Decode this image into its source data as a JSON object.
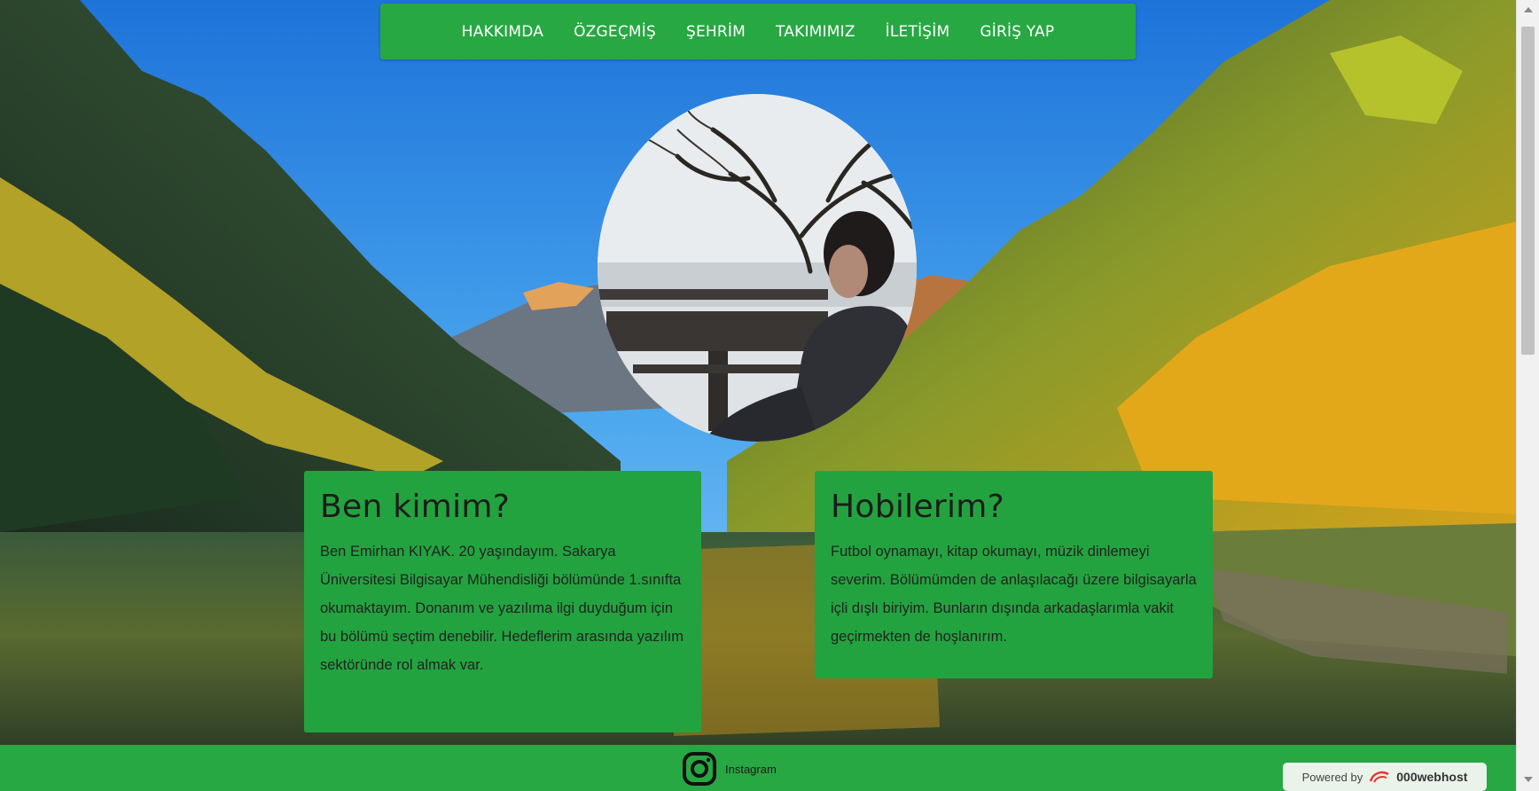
{
  "nav": {
    "items": [
      "HAKKIMDA",
      "ÖZGEÇMİŞ",
      "ŞEHRİM",
      "TAKIMIMIZ",
      "İLETİŞİM",
      "GİRİŞ YAP"
    ]
  },
  "about": {
    "title": "Ben kimim?",
    "text": "Ben Emirhan KIYAK. 20 yaşındayım. Sakarya Üniversitesi Bilgisayar Mühendisliği bölümünde 1.sınıfta okumaktayım. Donanım ve yazılıma ilgi duyduğum için bu bölümü seçtim denebilir. Hedeflerim arasında yazılım sektöründe rol almak var."
  },
  "hobbies": {
    "title": "Hobilerim?",
    "text": "Futbol oynamayı, kitap okumayı, müzik dinlemeyi severim. Bölümümden de anlaşılacağı üzere bilgisayarla içli dışlı biriyim. Bunların dışında arkadaşlarımla vakit geçirmekten de hoşlanırım."
  },
  "footer": {
    "instagram_label": "Instagram",
    "powered_prefix": "Powered by",
    "powered_brand": "000webhost"
  },
  "colors": {
    "accent_green": "#27a843",
    "card_green": "#23a33f"
  },
  "icons": {
    "instagram": "instagram-icon",
    "host_logo": "000webhost-logo-icon"
  }
}
